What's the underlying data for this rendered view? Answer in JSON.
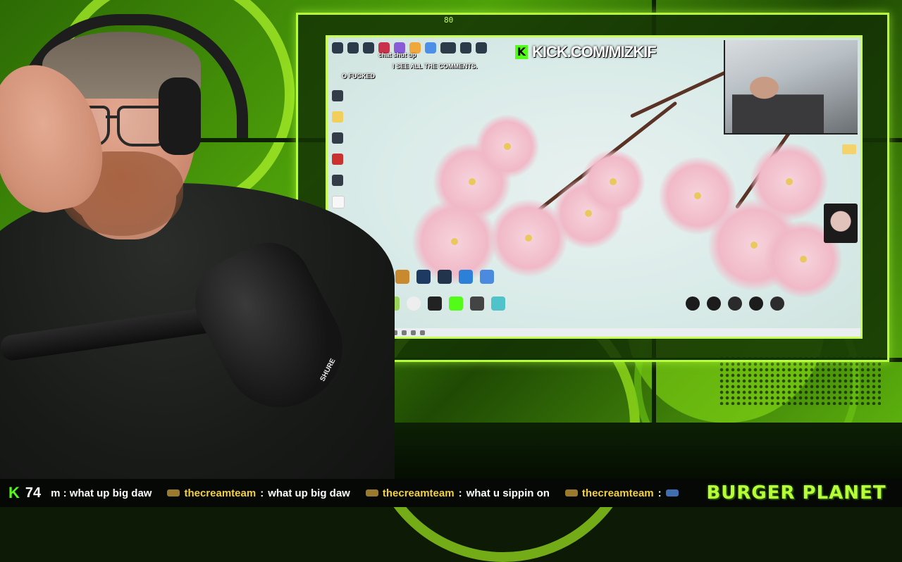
{
  "overlay": {
    "frame_tick": "80",
    "kick_url": "KICK.COM/MIZKIF",
    "kick_letter": "K",
    "desktop_chat": [
      "chat shut up",
      "I SEE ALL THE COMMENTS.",
      "O FUCKED"
    ]
  },
  "ticker": {
    "kick_letter": "K",
    "viewer_count": "74",
    "messages": [
      {
        "user": "",
        "text": "m : what up big daw"
      },
      {
        "user": "thecreamteam",
        "sep": ":",
        "text": "what up big daw"
      },
      {
        "user": "thecreamteam",
        "sep": ":",
        "text": "what u sippin on"
      },
      {
        "user": "thecreamteam",
        "sep": ":",
        "text": ""
      }
    ],
    "brand": "BURGER PLANET"
  },
  "mic_brand": "SHURE",
  "colors": {
    "accent_green": "#b6ff38",
    "kick_green": "#53fc18",
    "username_yellow": "#f4d03c"
  }
}
